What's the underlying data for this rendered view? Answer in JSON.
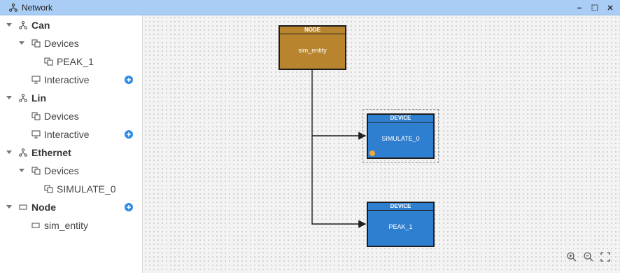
{
  "window": {
    "title": "Network",
    "icon": "network-icon"
  },
  "window_controls": [
    {
      "name": "minimize-icon"
    },
    {
      "name": "maximize-icon"
    },
    {
      "name": "close-icon"
    }
  ],
  "tree": {
    "can": {
      "label": "Can",
      "devices": "Devices",
      "device_items": [
        "PEAK_1"
      ],
      "interactive": "Interactive"
    },
    "lin": {
      "label": "Lin",
      "devices": "Devices",
      "interactive": "Interactive"
    },
    "ethernet": {
      "label": "Ethernet",
      "devices": "Devices",
      "device_items": [
        "SIMULATE_0"
      ]
    },
    "node": {
      "label": "Node",
      "items": [
        "sim_entity"
      ]
    }
  },
  "graph": {
    "nodes": [
      {
        "header": "NODE",
        "label": "sim_entity",
        "color": "#b8842e"
      },
      {
        "header": "DEVICE",
        "label": "SIMULATE_0",
        "color": "#2f7fd1",
        "selected": true
      },
      {
        "header": "DEVICE",
        "label": "PEAK_1",
        "color": "#2f7fd1"
      }
    ]
  },
  "colors": {
    "titlebar": "#a9cdf5",
    "accent": "#2f8ae8",
    "node_color": "#b8842e",
    "device_color": "#2f7fd1"
  },
  "zoom_controls": [
    "zoom-in-icon",
    "zoom-out-icon",
    "fit-screen-icon"
  ]
}
